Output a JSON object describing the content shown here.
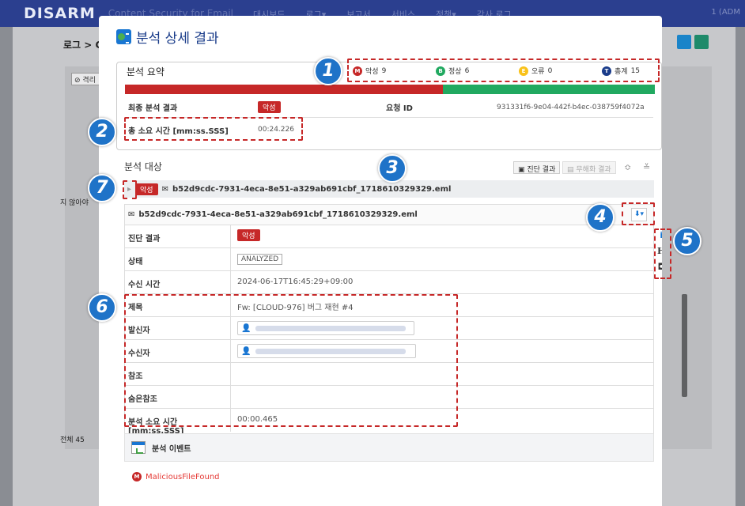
{
  "app": {
    "brand": "DISARM",
    "subtitle": "Content Security for Email",
    "nav": [
      "대시보드",
      "로그▾",
      "보고서",
      "서비스",
      "정책▾",
      "감사 로그"
    ],
    "user": "1 (ADM"
  },
  "background": {
    "breadcrumb": "로그 > C",
    "tag": "⊘ 격리",
    "left_text1": "지 않아야",
    "left_text2": "전체 45"
  },
  "modal": {
    "title": "분석 상세 결과",
    "summary": {
      "title": "분석 요약",
      "legend": [
        {
          "icon": "M",
          "label": "악성",
          "count": "9",
          "color": "#c62828"
        },
        {
          "icon": "B",
          "label": "정상",
          "count": "6",
          "color": "#21a960"
        },
        {
          "icon": "E",
          "label": "오류",
          "count": "0",
          "color": "#f9c21a"
        },
        {
          "icon": "T",
          "label": "총계",
          "count": "15",
          "color": "#1a3c8a"
        }
      ],
      "malicious_fraction": 0.6,
      "final_result_label": "최종 분석 결과",
      "final_result_value": "악성",
      "request_id_label": "요청 ID",
      "request_id": "931331f6-9e04-442f-b4ec-038759f4072a",
      "elapsed_label": "총 소요 시간 [mm:ss.SSS]",
      "elapsed_value": "00:24.226"
    },
    "targets": {
      "title": "분석 대상",
      "btn_diagnosis": "진단 결과",
      "btn_sanitize": "무해화 결과",
      "expand_icon": "≎",
      "collapse_icon": "≚",
      "object_badge": "악성",
      "object_name": "b52d9cdc-7931-4eca-8e51-a329ab691cbf_1718610329329.eml"
    },
    "detail": {
      "filename": "b52d9cdc-7931-4eca-8e51-a329ab691cbf_1718610329329.eml",
      "download_icon": "⬇▾",
      "rows": {
        "diagnosis": {
          "label": "진단 결과",
          "value": "악성"
        },
        "status": {
          "label": "상태",
          "value": "ANALYZED"
        },
        "received": {
          "label": "수신 시간",
          "value": "2024-06-17T16:45:29+09:00"
        },
        "subject": {
          "label": "제목",
          "value": "Fw: [CLOUD-976] 버그 재현 #4"
        },
        "sender": {
          "label": "발신자"
        },
        "recipient": {
          "label": "수신자"
        },
        "cc": {
          "label": "참조",
          "value": ""
        },
        "bcc": {
          "label": "숨은참조",
          "value": ""
        },
        "elapsed": {
          "label": "분석 소요 시간 [mm:ss.SSS]",
          "value": "00:00.465"
        }
      }
    },
    "side_icons": {
      "info": "i",
      "header": "H",
      "attach": "◘"
    },
    "events": {
      "title": "분석 이벤트",
      "items": [
        {
          "icon": "M",
          "label": "MaliciousFileFound"
        }
      ]
    }
  },
  "callouts": [
    "1",
    "2",
    "3",
    "4",
    "5",
    "6",
    "7"
  ],
  "colors": {
    "navy": "#2b3f8f",
    "malicious": "#c62828",
    "benign": "#21a960",
    "error": "#f9c21a",
    "total": "#1a3c8a",
    "callout": "#1f73c8",
    "dashed": "#c62828"
  }
}
